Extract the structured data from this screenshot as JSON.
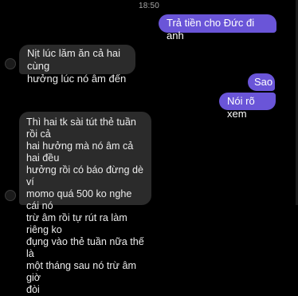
{
  "status_bar": {
    "time": "18:50"
  },
  "messages": [
    {
      "side": "sent",
      "text": "Trả tiền cho Đức đi anh"
    },
    {
      "side": "received",
      "text": "Nịt lúc lăm ăn cả hai cùng\nhưởng lúc nó âm đến"
    },
    {
      "side": "sent",
      "text": "Sao"
    },
    {
      "side": "sent",
      "text": "Nói rõ xem"
    },
    {
      "side": "received",
      "text": "Thì hai tk sài tút thẻ tuần rồi cả\nhai hưởng mà nó âm cả hai đều\nhưởng rồi có báo đừng dè ví\nmomo quá 500 ko nghe cái nó\ntrừ âm rồi tự rút ra làm riêng ko\nđụng vào thẻ tuần nữa thế là\nmột tháng sau nó trừ âm giờ\nđòi"
    }
  ],
  "colors": {
    "background": "#000000",
    "sent_bubble": "#6a55d8",
    "received_bubble": "#2b2b2b"
  }
}
